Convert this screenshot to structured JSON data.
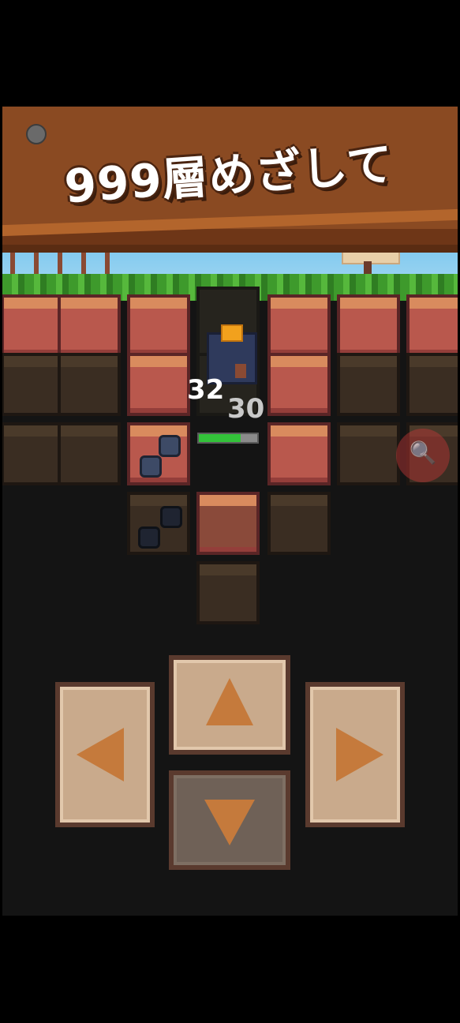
{
  "banner": {
    "title": "999層めざして"
  },
  "hud": {
    "damage_primary": "32",
    "damage_secondary": "30",
    "block_health": 0.72,
    "zoom_icon": "zoom-in-icon"
  },
  "controls": {
    "up": "arrow-up-icon",
    "down": "arrow-down-icon",
    "left": "arrow-left-icon",
    "right": "arrow-right-icon",
    "pressed": "down"
  },
  "colors": {
    "banner": "#8a4a22",
    "health_fill": "#33c23a",
    "button_face": "#c9aa8c",
    "arrow": "#c57a3c"
  }
}
